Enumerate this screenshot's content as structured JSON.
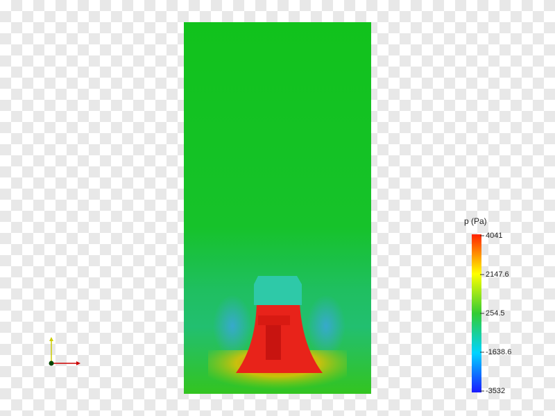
{
  "scalar_bar": {
    "title": "p (Pa)",
    "min": -3532,
    "max": 4041,
    "ticks": [
      4041,
      2147.6,
      254.5,
      -1638.6,
      -3532
    ],
    "tick_labels": [
      "4041",
      "2147.6",
      "254.5",
      "-1638.6",
      "-3532"
    ],
    "colormap": [
      "#1a1aff",
      "#00d4ff",
      "#33cc33",
      "#ffff00",
      "#ff2200"
    ]
  },
  "field": {
    "background_color": "#14c41e",
    "high_pressure_color": "#e8231a",
    "cap_color": "#2ec9a8",
    "low_pressure_color": "#2bb6c9"
  },
  "orientation_axes": {
    "x_color": "#cc0000",
    "y_color": "#cccc00",
    "origin_color": "#004400"
  }
}
